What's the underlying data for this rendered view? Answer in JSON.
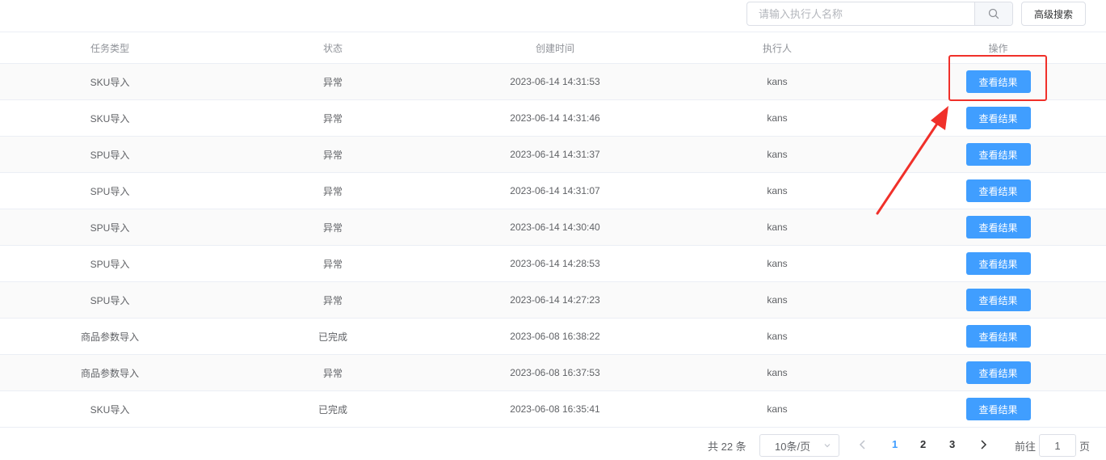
{
  "toolbar": {
    "search_placeholder": "请输入执行人名称",
    "search_value": "",
    "advanced_search_label": "高级搜索"
  },
  "table": {
    "headers": [
      "任务类型",
      "状态",
      "创建时间",
      "执行人",
      "操作"
    ],
    "rows": [
      {
        "type": "SKU导入",
        "status": "异常",
        "created": "2023-06-14 14:31:53",
        "executor": "kans",
        "action": "查看结果"
      },
      {
        "type": "SKU导入",
        "status": "异常",
        "created": "2023-06-14 14:31:46",
        "executor": "kans",
        "action": "查看结果"
      },
      {
        "type": "SPU导入",
        "status": "异常",
        "created": "2023-06-14 14:31:37",
        "executor": "kans",
        "action": "查看结果"
      },
      {
        "type": "SPU导入",
        "status": "异常",
        "created": "2023-06-14 14:31:07",
        "executor": "kans",
        "action": "查看结果"
      },
      {
        "type": "SPU导入",
        "status": "异常",
        "created": "2023-06-14 14:30:40",
        "executor": "kans",
        "action": "查看结果"
      },
      {
        "type": "SPU导入",
        "status": "异常",
        "created": "2023-06-14 14:28:53",
        "executor": "kans",
        "action": "查看结果"
      },
      {
        "type": "SPU导入",
        "status": "异常",
        "created": "2023-06-14 14:27:23",
        "executor": "kans",
        "action": "查看结果"
      },
      {
        "type": "商品参数导入",
        "status": "已完成",
        "created": "2023-06-08 16:38:22",
        "executor": "kans",
        "action": "查看结果"
      },
      {
        "type": "商品参数导入",
        "status": "异常",
        "created": "2023-06-08 16:37:53",
        "executor": "kans",
        "action": "查看结果"
      },
      {
        "type": "SKU导入",
        "status": "已完成",
        "created": "2023-06-08 16:35:41",
        "executor": "kans",
        "action": "查看结果"
      }
    ]
  },
  "pagination": {
    "total_label": "共 22 条",
    "page_size_label": "10条/页",
    "pages": [
      "1",
      "2",
      "3"
    ],
    "current_page": "1",
    "goto_label": "前往",
    "goto_value": "1",
    "goto_suffix": "页"
  },
  "annotation": {
    "highlight_color": "#f0302a",
    "target": "row-1-view-result-button"
  },
  "colors": {
    "primary": "#409eff",
    "border": "#ebeef5",
    "header_text": "#909399",
    "body_text": "#606266"
  },
  "icons": {
    "search": "search-icon",
    "chevron_down": "chevron-down-icon",
    "prev": "chevron-left-icon",
    "next": "chevron-right-icon"
  }
}
